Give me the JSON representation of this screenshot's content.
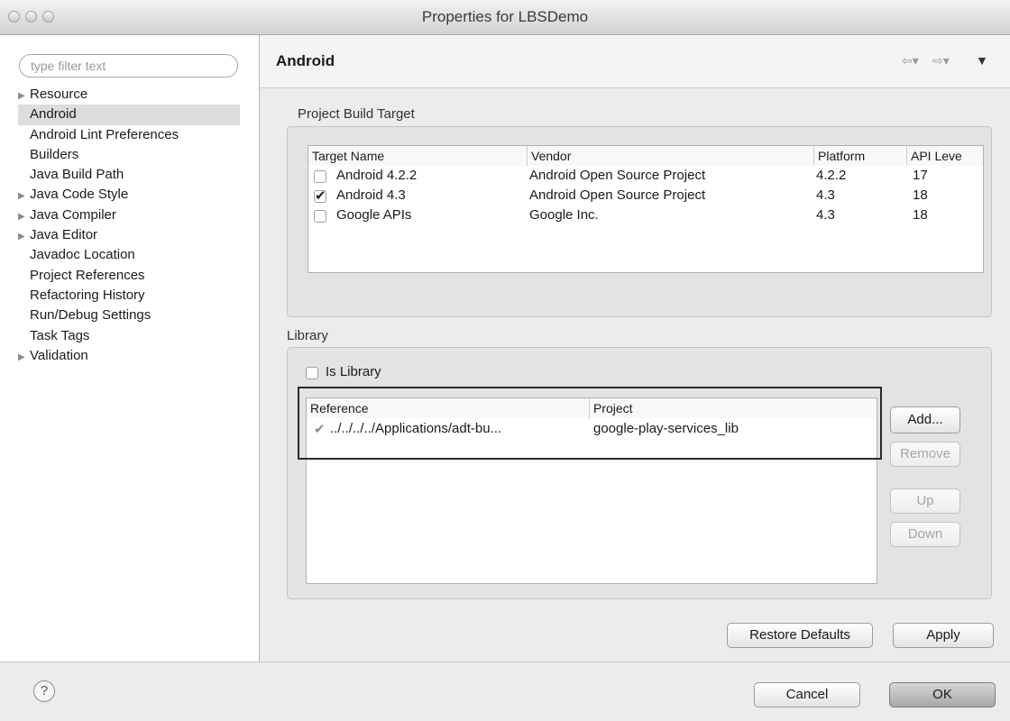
{
  "window": {
    "title": "Properties for LBSDemo"
  },
  "filter": {
    "placeholder": "type filter text"
  },
  "tree": [
    {
      "label": "Resource",
      "expandable": true
    },
    {
      "label": "Android",
      "expandable": false,
      "selected": true
    },
    {
      "label": "Android Lint Preferences",
      "expandable": false
    },
    {
      "label": "Builders",
      "expandable": false
    },
    {
      "label": "Java Build Path",
      "expandable": false
    },
    {
      "label": "Java Code Style",
      "expandable": true
    },
    {
      "label": "Java Compiler",
      "expandable": true
    },
    {
      "label": "Java Editor",
      "expandable": true
    },
    {
      "label": "Javadoc Location",
      "expandable": false
    },
    {
      "label": "Project References",
      "expandable": false
    },
    {
      "label": "Refactoring History",
      "expandable": false
    },
    {
      "label": "Run/Debug Settings",
      "expandable": false
    },
    {
      "label": "Task Tags",
      "expandable": false
    },
    {
      "label": "Validation",
      "expandable": true
    }
  ],
  "page": {
    "title": "Android",
    "build_target": {
      "group_label": "Project Build Target",
      "columns": [
        "Target Name",
        "Vendor",
        "Platform",
        "API Leve"
      ],
      "rows": [
        {
          "checked": false,
          "name": "Android 4.2.2",
          "vendor": "Android Open Source Project",
          "platform": "4.2.2",
          "api": "17"
        },
        {
          "checked": true,
          "name": "Android 4.3",
          "vendor": "Android Open Source Project",
          "platform": "4.3",
          "api": "18"
        },
        {
          "checked": false,
          "name": "Google APIs",
          "vendor": "Google Inc.",
          "platform": "4.3",
          "api": "18"
        }
      ]
    },
    "library": {
      "group_label": "Library",
      "is_library_label": "Is Library",
      "is_library_checked": false,
      "columns": [
        "Reference",
        "Project"
      ],
      "rows": [
        {
          "reference": "../../../../Applications/adt-bu...",
          "project": "google-play-services_lib"
        }
      ],
      "buttons": {
        "add": "Add...",
        "remove": "Remove",
        "up": "Up",
        "down": "Down"
      }
    },
    "restore_defaults": "Restore Defaults",
    "apply": "Apply"
  },
  "bottom": {
    "help": "?",
    "cancel": "Cancel",
    "ok": "OK"
  }
}
